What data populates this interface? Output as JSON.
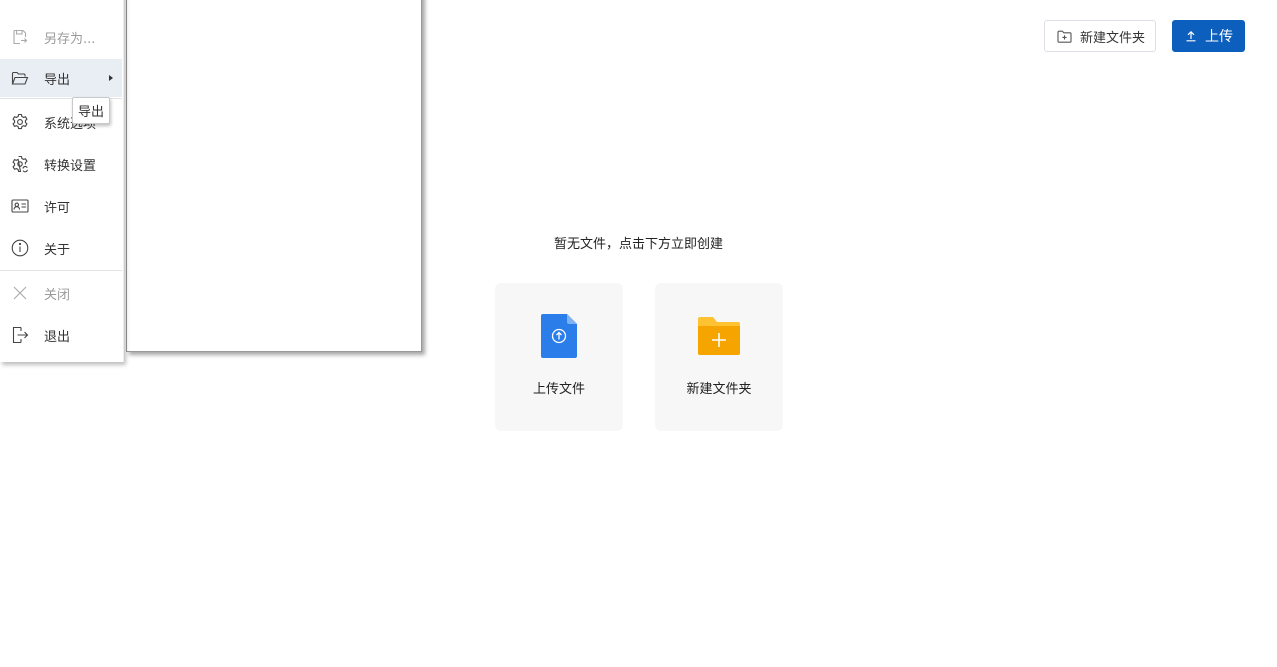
{
  "menu": {
    "items": [
      {
        "label": "另存为...",
        "icon": "save-as-icon",
        "disabled": true
      },
      {
        "label": "导出",
        "icon": "folder-open-export-icon",
        "has_submenu": true,
        "active": true
      },
      {
        "label": "系统选项",
        "icon": "gear-icon"
      },
      {
        "label": "转换设置",
        "icon": "gear-sync-icon"
      },
      {
        "label": "许可",
        "icon": "license-card-icon"
      },
      {
        "label": "关于",
        "icon": "info-icon"
      },
      {
        "label": "关闭",
        "icon": "close-icon",
        "disabled": true
      },
      {
        "label": "退出",
        "icon": "exit-icon"
      }
    ],
    "tooltip": "导出"
  },
  "toolbar": {
    "new_folder_label": "新建文件夹",
    "upload_label": "上传"
  },
  "empty_state": {
    "message": "暂无文件，点击下方立即创建",
    "cards": [
      {
        "label": "上传文件",
        "icon": "upload-file-icon"
      },
      {
        "label": "新建文件夹",
        "icon": "new-folder-icon"
      }
    ]
  },
  "colors": {
    "primary": "#0d5fbd",
    "file_icon_blue": "#2b7de9",
    "folder_icon_yellow": "#f5a400"
  }
}
